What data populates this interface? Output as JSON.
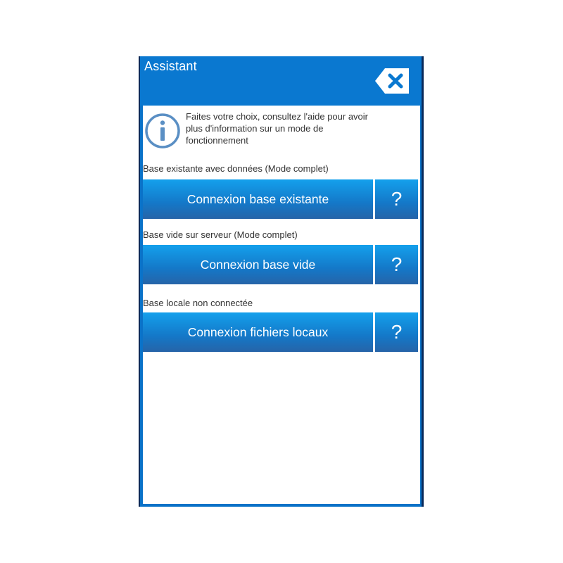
{
  "window": {
    "title": "Assistant"
  },
  "info": {
    "lines": [
      "Faites votre choix, consultez l'aide pour avoir",
      "plus d'information sur un mode de",
      "fonctionnement"
    ]
  },
  "options": [
    {
      "label": "Base existante avec données (Mode complet)",
      "button": "Connexion base existante",
      "help": "?"
    },
    {
      "label": "Base vide sur serveur (Mode complet)",
      "button": "Connexion base vide",
      "help": "?"
    },
    {
      "label": "Base locale non connectée",
      "button": "Connexion fichiers locaux",
      "help": "?"
    }
  ],
  "colors": {
    "header": "#0a78d0",
    "button_top": "#14a0ec",
    "button_bottom": "#2664a8",
    "info_icon": "#5a8fc4"
  },
  "icons": {
    "close": "close-icon",
    "info": "info-icon"
  }
}
